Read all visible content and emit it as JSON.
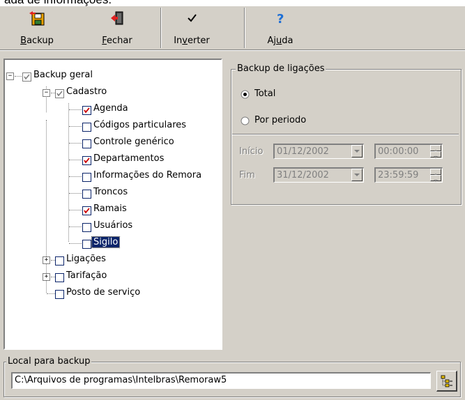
{
  "title_fragment": "ada de informações.",
  "toolbar": {
    "backup": {
      "label_underlined": "B",
      "label_rest": "ackup"
    },
    "fechar": {
      "label_underlined": "F",
      "label_rest": "echar"
    },
    "inverter": {
      "label_pre": "In",
      "label_underlined": "v",
      "label_rest": "erter"
    },
    "ajuda": {
      "label_pre": "Aj",
      "label_underlined": "u",
      "label_rest": "da"
    }
  },
  "tree": {
    "root": {
      "label": "Backup geral",
      "checked": "gray"
    },
    "cadastro": {
      "label": "Cadastro",
      "checked": "gray"
    },
    "cadastro_items": [
      {
        "label": "Agenda",
        "checked": true
      },
      {
        "label": "Códigos particulares",
        "checked": false
      },
      {
        "label": "Controle genérico",
        "checked": false
      },
      {
        "label": "Departamentos",
        "checked": true
      },
      {
        "label": "Informações do Remora",
        "checked": false
      },
      {
        "label": "Troncos",
        "checked": false
      },
      {
        "label": "Ramais",
        "checked": true
      },
      {
        "label": "Usuários",
        "checked": false
      },
      {
        "label": "Sigilo",
        "checked": false,
        "selected": true
      }
    ],
    "ligacoes": {
      "label": "Ligações",
      "checked": false
    },
    "tarifacao": {
      "label": "Tarifação",
      "checked": false
    },
    "posto": {
      "label": "Posto de serviço",
      "checked": false
    }
  },
  "backup_ligacoes": {
    "legend": "Backup de ligações",
    "total_label": "Total",
    "por_periodo_label": "Por periodo",
    "selected_option": "Total",
    "inicio_label": "Início",
    "inicio_date": "01/12/2002",
    "inicio_time": "00:00:00",
    "fim_label": "Fim",
    "fim_date": "31/12/2002",
    "fim_time": "23:59:59"
  },
  "local_backup": {
    "legend": "Local para backup",
    "path": "C:\\Arquivos de programas\\Intelbras\\Remoraw5"
  },
  "colors": {
    "window_bg": "#d4d0c8",
    "selection": "#0a246a",
    "check_red": "#cc0000"
  }
}
